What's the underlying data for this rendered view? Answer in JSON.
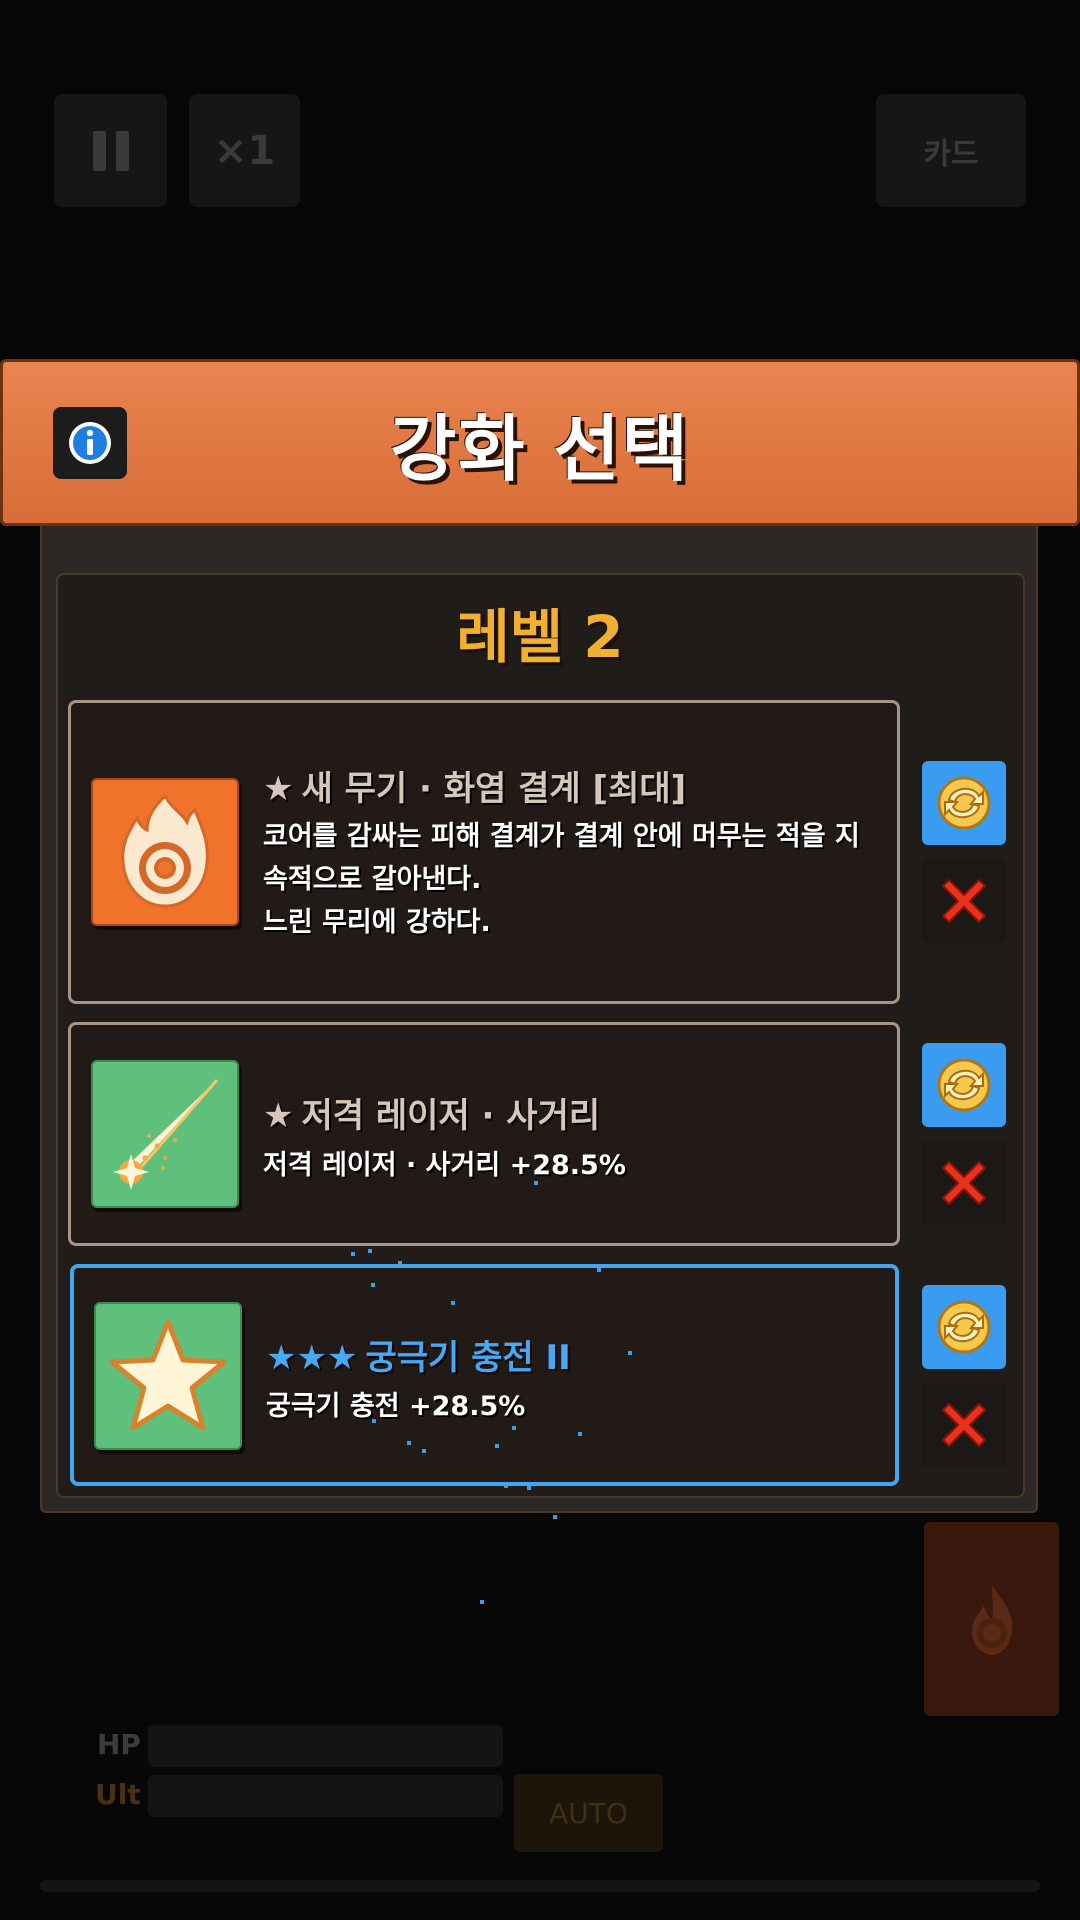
{
  "hud": {
    "speed_label": "×1",
    "card_label": "카드",
    "hp_label": "HP",
    "ult_label": "Ult",
    "auto_label": "AUTO"
  },
  "modal": {
    "title": "강화 선택",
    "level_label": "레벨 2",
    "choices": [
      {
        "stars": "★",
        "name": "새 무기 · 화염 결계  [최대]",
        "description": "코어를 감싸는 피해 결계가 결계 안에 머무는 적을 지\n속적으로 갈아낸다.\n느린 무리에 강하다.",
        "icon": "fire-ring-icon",
        "icon_bg": "#f0722b",
        "selected": false
      },
      {
        "stars": "★",
        "name": "저격 레이저 · 사거리",
        "description": "저격 레이저 · 사거리 +28.5%",
        "icon": "laser-beam-icon",
        "icon_bg": "#5ec07a",
        "selected": false
      },
      {
        "stars": "★★★",
        "name": "궁극기 충전 II",
        "description": "궁극기 충전 +28.5%",
        "icon": "star-icon",
        "icon_bg": "#5ec07a",
        "selected": true
      }
    ]
  },
  "colors": {
    "header": "#e07a44",
    "level_text": "#f1b031",
    "selected_border": "#41a5f0",
    "reroll_button": "#3a9cf0",
    "remove_x": "#e8321c"
  }
}
